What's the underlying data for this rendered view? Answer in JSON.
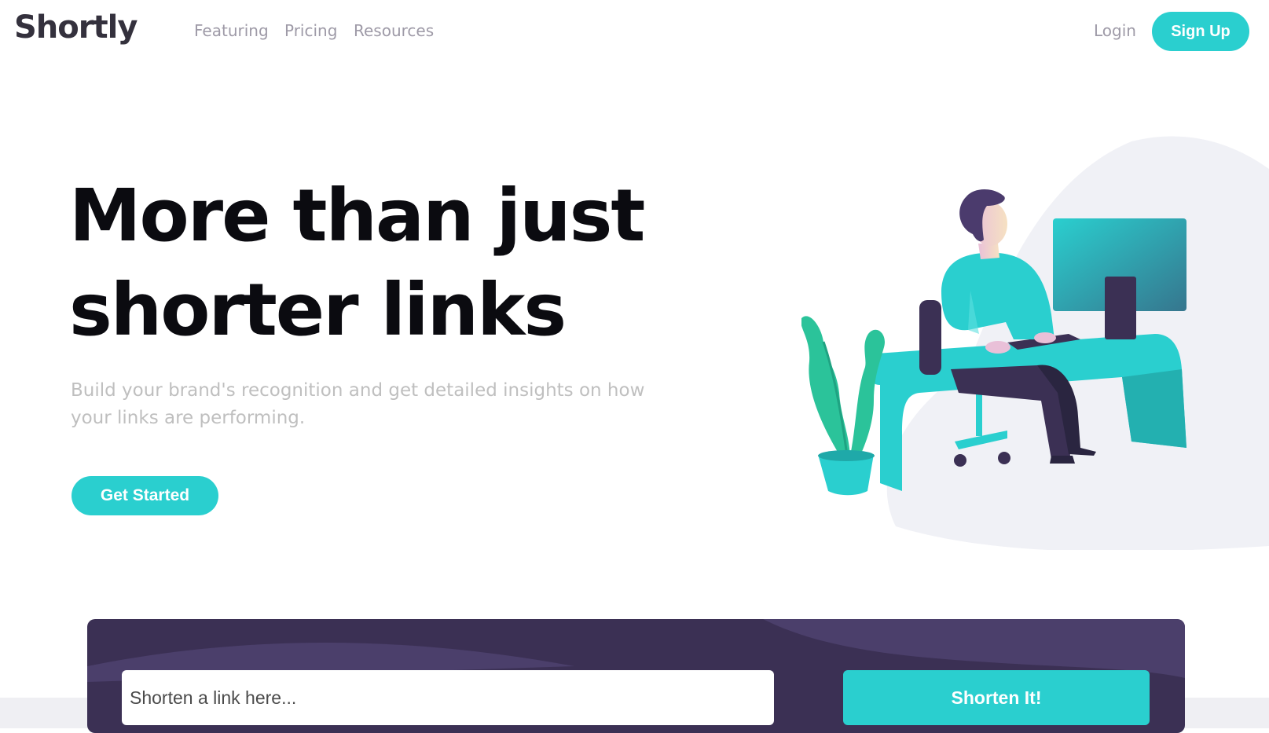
{
  "header": {
    "logo": "Shortly",
    "nav": [
      {
        "label": "Featuring"
      },
      {
        "label": "Pricing"
      },
      {
        "label": "Resources"
      }
    ],
    "login_label": "Login",
    "signup_label": "Sign Up"
  },
  "hero": {
    "title": "More than just shorter links",
    "subtitle": "Build your brand's recognition and get detailed insights on how your links are performing.",
    "cta_label": "Get Started",
    "illustration": "person-working-at-desk-illustration"
  },
  "shorten": {
    "placeholder": "Shorten a link here...",
    "button_label": "Shorten It!"
  },
  "colors": {
    "accent": "#2acfcf",
    "dark_violet": "#3b3054",
    "heading": "#0b0b10",
    "muted_text": "#9e9aa7"
  }
}
